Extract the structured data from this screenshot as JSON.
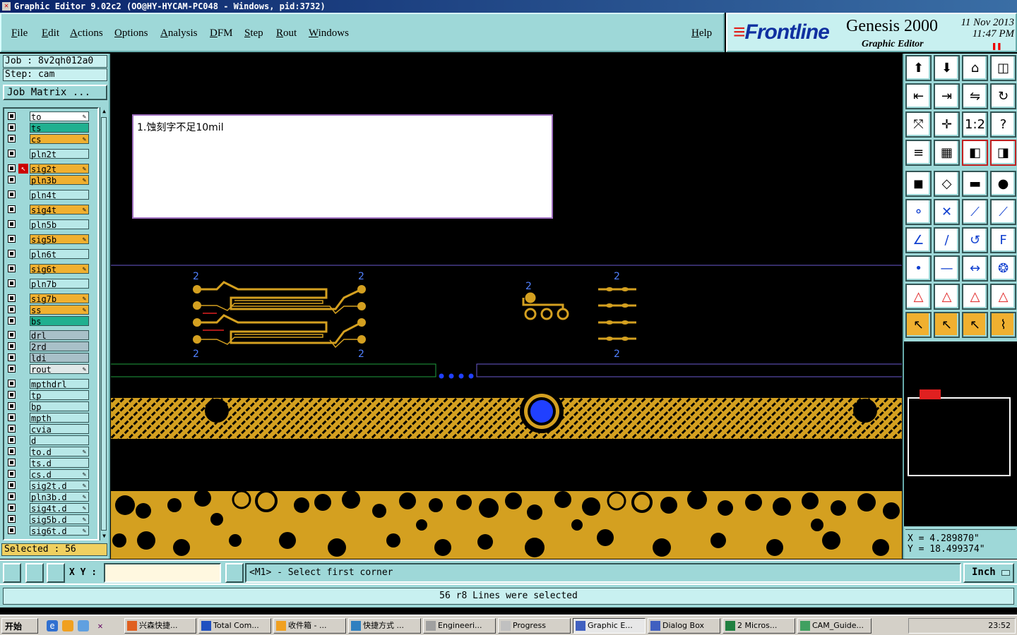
{
  "window": {
    "title": "Graphic Editor 9.02c2 (OO@HY-HYCAM-PC048 - Windows, pid:3732)"
  },
  "menu": {
    "items": [
      "File",
      "Edit",
      "Actions",
      "Options",
      "Analysis",
      "DFM",
      "Step",
      "Rout",
      "Windows"
    ],
    "help": "Help"
  },
  "logo": {
    "brand": "Frontline",
    "product": "Genesis 2000",
    "subtitle": "Graphic Editor",
    "date": "11 Nov 2013",
    "time": "11:47 PM"
  },
  "left_panel": {
    "job": "Job : 8v2qh012a0",
    "step": "Step: cam",
    "job_matrix": "Job Matrix ...",
    "selected": "Selected : 56",
    "layers": [
      {
        "name": "to",
        "color": "#ffffff",
        "editable": true
      },
      {
        "name": "ts",
        "color": "#20b090",
        "editable": false
      },
      {
        "name": "cs",
        "color": "#f0b030",
        "editable": true
      },
      {
        "name": "pln2t",
        "color": "#b8e8e8",
        "editable": false
      },
      {
        "name": "sig2t",
        "color": "#f0b030",
        "editable": true,
        "work": true
      },
      {
        "name": "pln3b",
        "color": "#f0b030",
        "editable": true
      },
      {
        "name": "pln4t",
        "color": "#b8e8e8",
        "editable": false
      },
      {
        "name": "sig4t",
        "color": "#f0b030",
        "editable": true
      },
      {
        "name": "pln5b",
        "color": "#b8e8e8",
        "editable": false
      },
      {
        "name": "sig5b",
        "color": "#f0b030",
        "editable": true
      },
      {
        "name": "pln6t",
        "color": "#b8e8e8",
        "editable": false
      },
      {
        "name": "sig6t",
        "color": "#f0b030",
        "editable": true
      },
      {
        "name": "pln7b",
        "color": "#b8e8e8",
        "editable": false
      },
      {
        "name": "sig7b",
        "color": "#f0b030",
        "editable": true
      },
      {
        "name": "ss",
        "color": "#f0b030",
        "editable": true
      },
      {
        "name": "bs",
        "color": "#20b090",
        "editable": false
      },
      {
        "name": "drl",
        "color": "#a8c0c8",
        "editable": false
      },
      {
        "name": "2rd",
        "color": "#a8c0c8",
        "editable": false
      },
      {
        "name": "ldi",
        "color": "#a8c0c8",
        "editable": false
      },
      {
        "name": "rout",
        "color": "#e0e8e8",
        "editable": true
      },
      {
        "name": "mpthdrl",
        "color": "#b8e8e8",
        "editable": false
      },
      {
        "name": "tp",
        "color": "#b8e8e8",
        "editable": false
      },
      {
        "name": "bp",
        "color": "#b8e8e8",
        "editable": false
      },
      {
        "name": "mpth",
        "color": "#b8e8e8",
        "editable": false
      },
      {
        "name": "cvia",
        "color": "#b8e8e8",
        "editable": false
      },
      {
        "name": "d",
        "color": "#b8e8e8",
        "editable": false
      },
      {
        "name": "to.d",
        "color": "#b8e8e8",
        "editable": true
      },
      {
        "name": "ts.d",
        "color": "#b8e8e8",
        "editable": false
      },
      {
        "name": "cs.d",
        "color": "#b8e8e8",
        "editable": true
      },
      {
        "name": "sig2t.d",
        "color": "#b8e8e8",
        "editable": true
      },
      {
        "name": "pln3b.d",
        "color": "#b8e8e8",
        "editable": true
      },
      {
        "name": "sig4t.d",
        "color": "#b8e8e8",
        "editable": true
      },
      {
        "name": "sig5b.d",
        "color": "#b8e8e8",
        "editable": true
      },
      {
        "name": "sig6t.d",
        "color": "#b8e8e8",
        "editable": true
      }
    ]
  },
  "canvas": {
    "note": "1.蚀刻字不足10mil",
    "pad_label": "2"
  },
  "right_panel": {
    "coord_x": "X = 4.289870\"",
    "coord_y": "Y = 18.499374\""
  },
  "command_bar": {
    "xy_label": "X Y :",
    "xy_value": "",
    "prompt": "<M1> - Select first corner",
    "units": "Inch"
  },
  "status": {
    "message": "56 r8 Lines were selected"
  },
  "taskbar": {
    "start": "开始",
    "tasks": [
      {
        "label": "兴森快捷...",
        "active": false
      },
      {
        "label": "Total Com...",
        "active": false
      },
      {
        "label": "收件箱 - ...",
        "active": false
      },
      {
        "label": "快捷方式 ...",
        "active": false
      },
      {
        "label": "Engineeri...",
        "active": false
      },
      {
        "label": "Progress",
        "active": false
      },
      {
        "label": "Graphic E...",
        "active": true
      },
      {
        "label": "Dialog Box",
        "active": false
      },
      {
        "label": "2 Micros...",
        "active": false
      },
      {
        "label": "CAM_Guide...",
        "active": false
      }
    ],
    "clock": "23:52"
  },
  "colors": {
    "panel": "#9ed8d8",
    "copper": "#d4a020",
    "via_blue": "#2040ff",
    "highlight": "#e02020"
  }
}
